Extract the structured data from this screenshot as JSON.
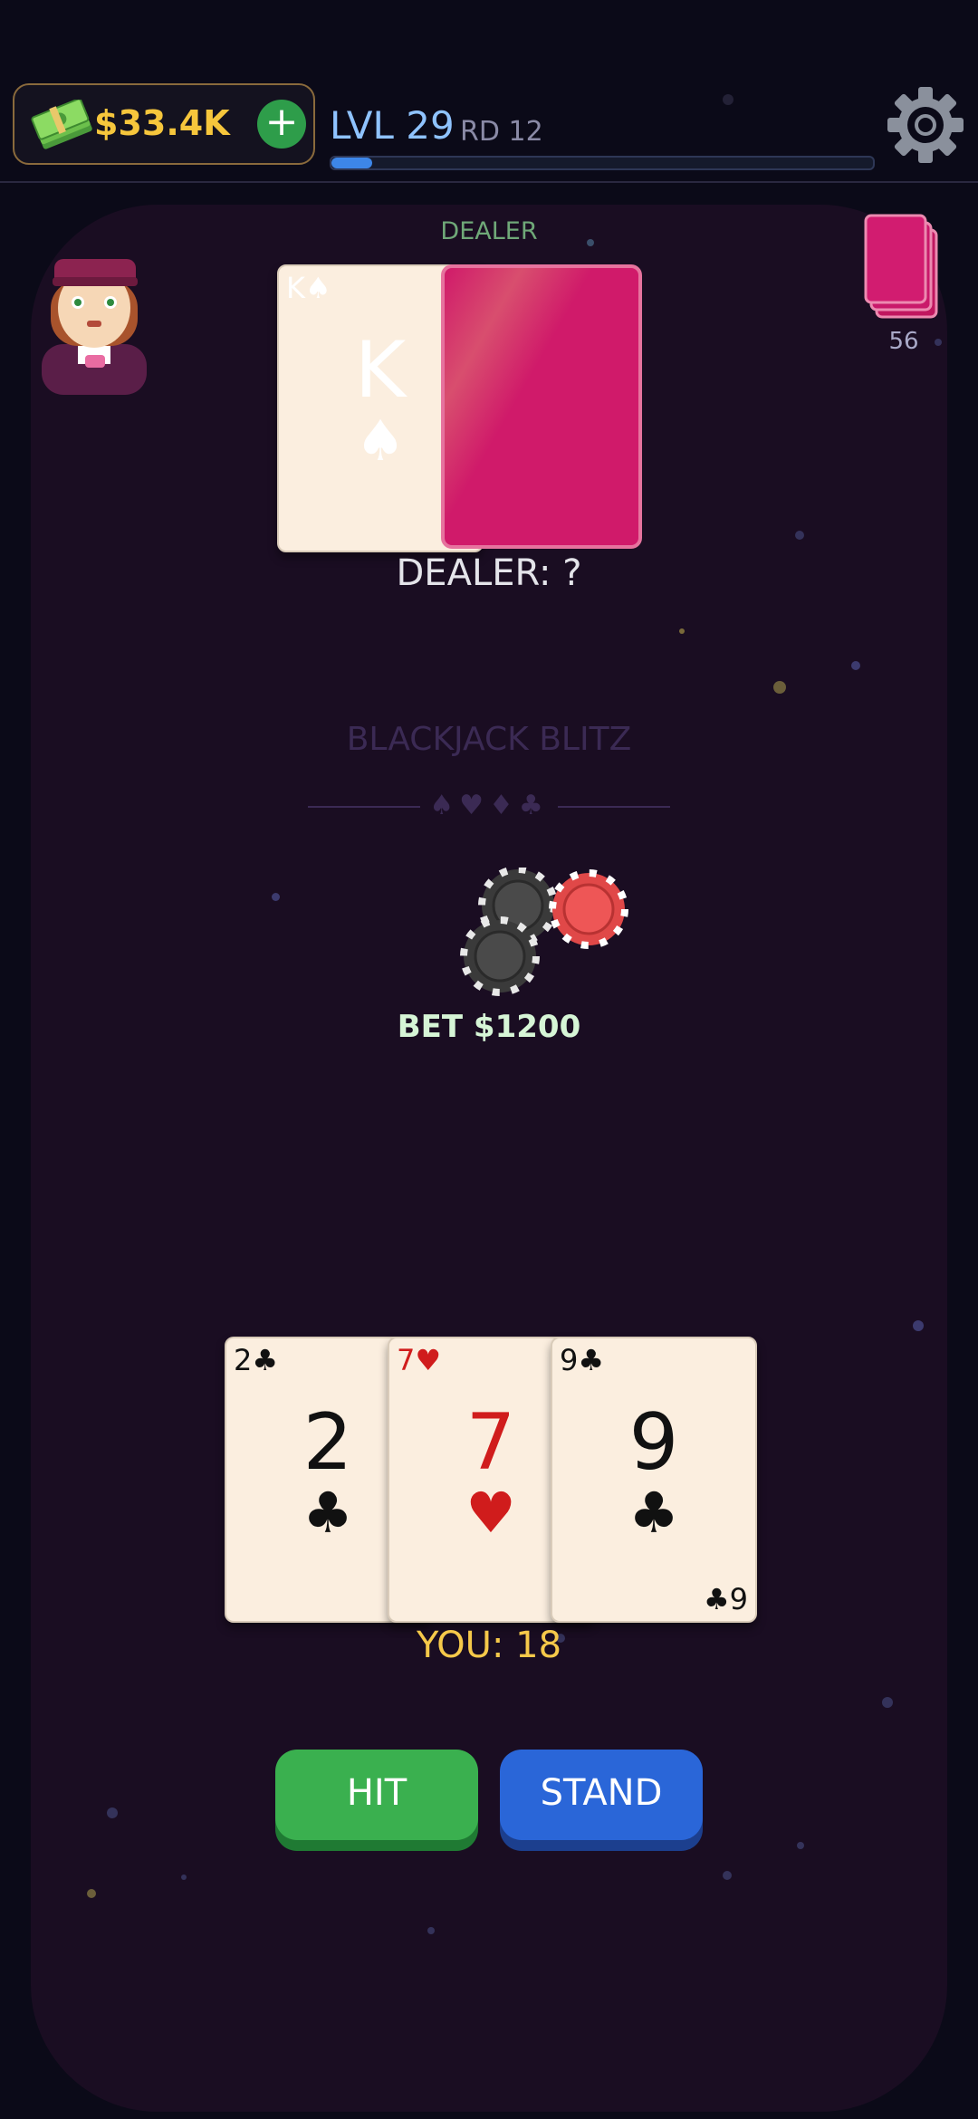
{
  "hud": {
    "cash": "$33.4K",
    "add_label": "+",
    "level": "LVL 29",
    "round": "RD 12",
    "xp_progress": 0.075
  },
  "deck": {
    "count": "56"
  },
  "dealer": {
    "label": "DEALER",
    "cards": [
      {
        "rank": "K",
        "suit": "♠",
        "color": "#111111"
      }
    ],
    "hidden_card_color": "#d01a6a",
    "score_text": "DEALER: ?"
  },
  "table": {
    "title": "BLACKJACK BLITZ",
    "suits": "♠♥♦♣",
    "bet_text": "BET $1200"
  },
  "player": {
    "cards": [
      {
        "rank": "2",
        "suit": "♣",
        "color": "#111111"
      },
      {
        "rank": "7",
        "suit": "♥",
        "color": "#d01c1c"
      },
      {
        "rank": "9",
        "suit": "♣",
        "color": "#111111"
      }
    ],
    "score_text": "YOU: 18"
  },
  "actions": {
    "hit": "HIT",
    "stand": "STAND"
  },
  "colors": {
    "accent_gold": "#f6c63c",
    "hit_green": "#3ab04f",
    "stand_blue": "#2a66d8",
    "table": "#1a0d22"
  }
}
